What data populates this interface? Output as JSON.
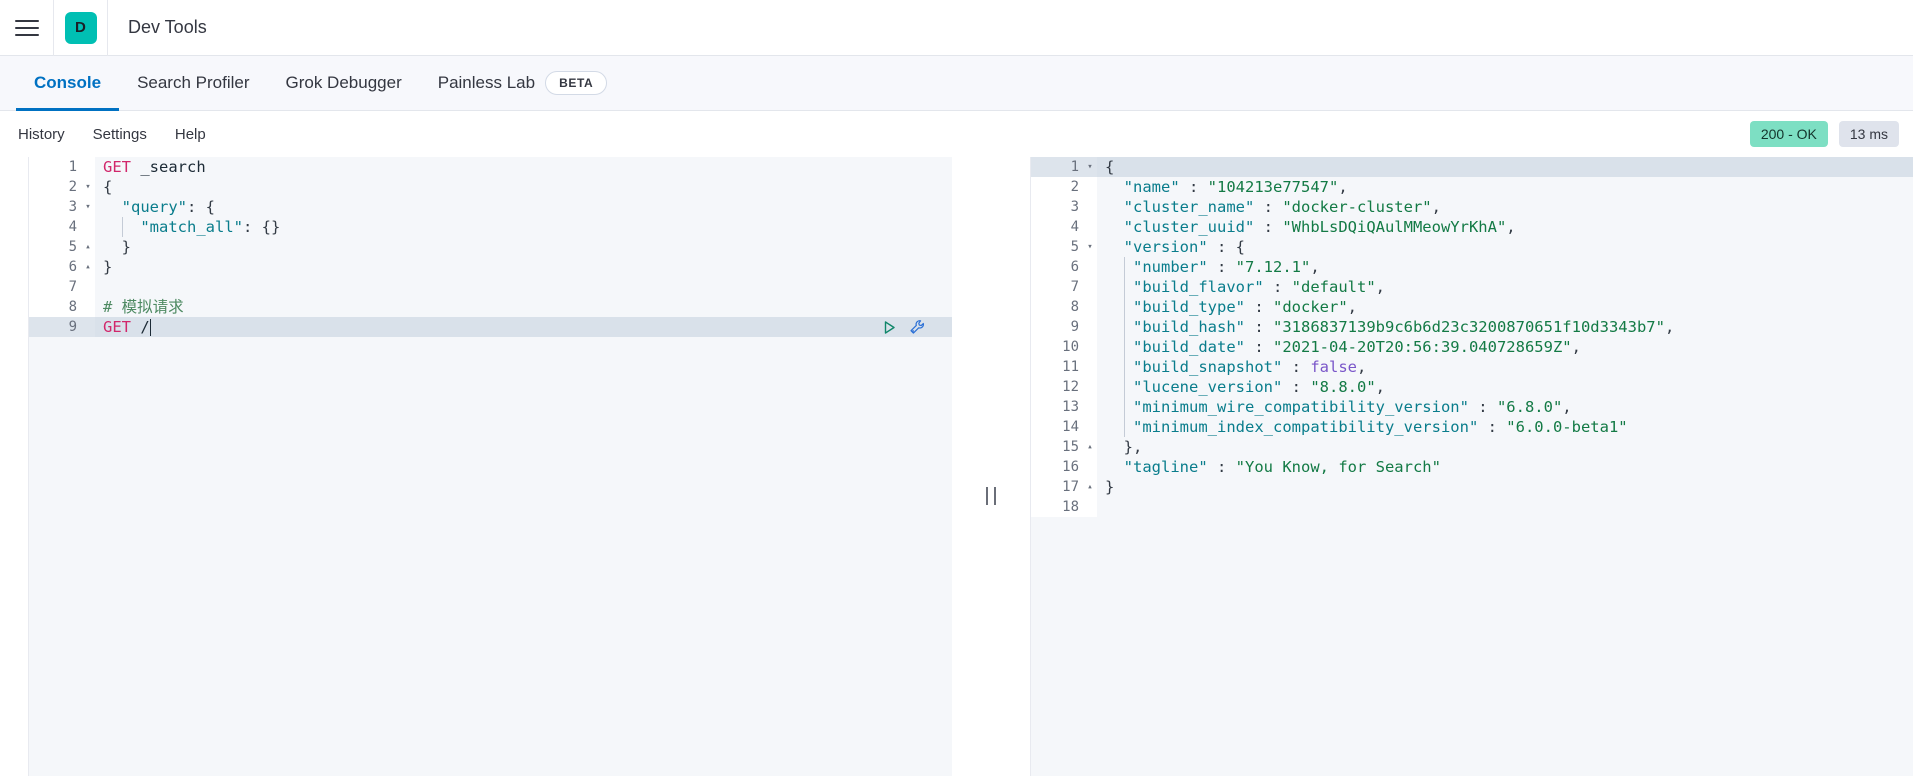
{
  "header": {
    "menu_icon": "hamburger-menu-icon",
    "logo_letter": "D",
    "logo_color": "#00bfb3",
    "title": "Dev Tools"
  },
  "tabs": [
    {
      "label": "Console",
      "active": true,
      "badge": null
    },
    {
      "label": "Search Profiler",
      "active": false,
      "badge": null
    },
    {
      "label": "Grok Debugger",
      "active": false,
      "badge": null
    },
    {
      "label": "Painless Lab",
      "active": false,
      "badge": "BETA"
    }
  ],
  "console_menu": {
    "items": [
      "History",
      "Settings",
      "Help"
    ]
  },
  "status": {
    "code_label": "200 - OK",
    "code_color": "#7ddfc3",
    "time_label": "13 ms",
    "time_color": "#dfe3ec"
  },
  "request_editor": {
    "active_line": 9,
    "actions": [
      {
        "name": "play-request-icon",
        "color": "#10866a"
      },
      {
        "name": "wrench-icon",
        "color": "#2a6fd6"
      }
    ],
    "lines": [
      {
        "n": 1,
        "fold": "",
        "tokens": [
          {
            "t": "GET",
            "c": "k-method"
          },
          {
            "t": " _search",
            "c": "k-url"
          }
        ]
      },
      {
        "n": 2,
        "fold": "▾",
        "tokens": [
          {
            "t": "{",
            "c": "k-punct"
          }
        ]
      },
      {
        "n": 3,
        "fold": "▾",
        "tokens": [
          {
            "t": "  ",
            "c": "k-punct"
          },
          {
            "t": "\"query\"",
            "c": "k-key"
          },
          {
            "t": ": {",
            "c": "k-punct"
          }
        ]
      },
      {
        "n": 4,
        "fold": "",
        "tokens": [
          {
            "t": "  ",
            "c": "k-punct"
          },
          {
            "t": "|",
            "c": "guide"
          },
          {
            "t": "  ",
            "c": "k-punct"
          },
          {
            "t": "\"match_all\"",
            "c": "k-key"
          },
          {
            "t": ": {}",
            "c": "k-punct"
          }
        ]
      },
      {
        "n": 5,
        "fold": "▴",
        "tokens": [
          {
            "t": "  }",
            "c": "k-punct"
          }
        ]
      },
      {
        "n": 6,
        "fold": "▴",
        "tokens": [
          {
            "t": "}",
            "c": "k-punct"
          }
        ]
      },
      {
        "n": 7,
        "fold": "",
        "tokens": []
      },
      {
        "n": 8,
        "fold": "",
        "tokens": [
          {
            "t": "# 模拟请求",
            "c": "k-comment"
          }
        ]
      },
      {
        "n": 9,
        "fold": "",
        "tokens": [
          {
            "t": "GET",
            "c": "k-method"
          },
          {
            "t": " /",
            "c": "k-url"
          },
          {
            "t": "|caret|",
            "c": "caret"
          }
        ]
      }
    ]
  },
  "response_editor": {
    "active_line": 1,
    "lines": [
      {
        "n": 1,
        "fold": "▾",
        "tokens": [
          {
            "t": "{",
            "c": "k-punct"
          }
        ]
      },
      {
        "n": 2,
        "fold": "",
        "tokens": [
          {
            "t": "  ",
            "c": "k-punct"
          },
          {
            "t": "\"name\"",
            "c": "k-rkey"
          },
          {
            "t": " : ",
            "c": "k-punct"
          },
          {
            "t": "\"104213e77547\"",
            "c": "k-str"
          },
          {
            "t": ",",
            "c": "k-punct"
          }
        ]
      },
      {
        "n": 3,
        "fold": "",
        "tokens": [
          {
            "t": "  ",
            "c": "k-punct"
          },
          {
            "t": "\"cluster_name\"",
            "c": "k-rkey"
          },
          {
            "t": " : ",
            "c": "k-punct"
          },
          {
            "t": "\"docker-cluster\"",
            "c": "k-str"
          },
          {
            "t": ",",
            "c": "k-punct"
          }
        ]
      },
      {
        "n": 4,
        "fold": "",
        "tokens": [
          {
            "t": "  ",
            "c": "k-punct"
          },
          {
            "t": "\"cluster_uuid\"",
            "c": "k-rkey"
          },
          {
            "t": " : ",
            "c": "k-punct"
          },
          {
            "t": "\"WhbLsDQiQAulMMeowYrKhA\"",
            "c": "k-str"
          },
          {
            "t": ",",
            "c": "k-punct"
          }
        ]
      },
      {
        "n": 5,
        "fold": "▾",
        "tokens": [
          {
            "t": "  ",
            "c": "k-punct"
          },
          {
            "t": "\"version\"",
            "c": "k-rkey"
          },
          {
            "t": " : {",
            "c": "k-punct"
          }
        ]
      },
      {
        "n": 6,
        "fold": "",
        "tokens": [
          {
            "t": "  ",
            "c": "k-punct"
          },
          {
            "t": "|",
            "c": "guide"
          },
          {
            "t": " ",
            "c": "k-punct"
          },
          {
            "t": "\"number\"",
            "c": "k-rkey"
          },
          {
            "t": " : ",
            "c": "k-punct"
          },
          {
            "t": "\"7.12.1\"",
            "c": "k-str"
          },
          {
            "t": ",",
            "c": "k-punct"
          }
        ]
      },
      {
        "n": 7,
        "fold": "",
        "tokens": [
          {
            "t": "  ",
            "c": "k-punct"
          },
          {
            "t": "|",
            "c": "guide"
          },
          {
            "t": " ",
            "c": "k-punct"
          },
          {
            "t": "\"build_flavor\"",
            "c": "k-rkey"
          },
          {
            "t": " : ",
            "c": "k-punct"
          },
          {
            "t": "\"default\"",
            "c": "k-str"
          },
          {
            "t": ",",
            "c": "k-punct"
          }
        ]
      },
      {
        "n": 8,
        "fold": "",
        "tokens": [
          {
            "t": "  ",
            "c": "k-punct"
          },
          {
            "t": "|",
            "c": "guide"
          },
          {
            "t": " ",
            "c": "k-punct"
          },
          {
            "t": "\"build_type\"",
            "c": "k-rkey"
          },
          {
            "t": " : ",
            "c": "k-punct"
          },
          {
            "t": "\"docker\"",
            "c": "k-str"
          },
          {
            "t": ",",
            "c": "k-punct"
          }
        ]
      },
      {
        "n": 9,
        "fold": "",
        "tokens": [
          {
            "t": "  ",
            "c": "k-punct"
          },
          {
            "t": "|",
            "c": "guide"
          },
          {
            "t": " ",
            "c": "k-punct"
          },
          {
            "t": "\"build_hash\"",
            "c": "k-rkey"
          },
          {
            "t": " : ",
            "c": "k-punct"
          },
          {
            "t": "\"3186837139b9c6b6d23c3200870651f10d3343b7\"",
            "c": "k-str"
          },
          {
            "t": ",",
            "c": "k-punct"
          }
        ]
      },
      {
        "n": 10,
        "fold": "",
        "tokens": [
          {
            "t": "  ",
            "c": "k-punct"
          },
          {
            "t": "|",
            "c": "guide"
          },
          {
            "t": " ",
            "c": "k-punct"
          },
          {
            "t": "\"build_date\"",
            "c": "k-rkey"
          },
          {
            "t": " : ",
            "c": "k-punct"
          },
          {
            "t": "\"2021-04-20T20:56:39.040728659Z\"",
            "c": "k-str"
          },
          {
            "t": ",",
            "c": "k-punct"
          }
        ]
      },
      {
        "n": 11,
        "fold": "",
        "tokens": [
          {
            "t": "  ",
            "c": "k-punct"
          },
          {
            "t": "|",
            "c": "guide"
          },
          {
            "t": " ",
            "c": "k-punct"
          },
          {
            "t": "\"build_snapshot\"",
            "c": "k-rkey"
          },
          {
            "t": " : ",
            "c": "k-punct"
          },
          {
            "t": "false",
            "c": "k-bool"
          },
          {
            "t": ",",
            "c": "k-punct"
          }
        ]
      },
      {
        "n": 12,
        "fold": "",
        "tokens": [
          {
            "t": "  ",
            "c": "k-punct"
          },
          {
            "t": "|",
            "c": "guide"
          },
          {
            "t": " ",
            "c": "k-punct"
          },
          {
            "t": "\"lucene_version\"",
            "c": "k-rkey"
          },
          {
            "t": " : ",
            "c": "k-punct"
          },
          {
            "t": "\"8.8.0\"",
            "c": "k-str"
          },
          {
            "t": ",",
            "c": "k-punct"
          }
        ]
      },
      {
        "n": 13,
        "fold": "",
        "tokens": [
          {
            "t": "  ",
            "c": "k-punct"
          },
          {
            "t": "|",
            "c": "guide"
          },
          {
            "t": " ",
            "c": "k-punct"
          },
          {
            "t": "\"minimum_wire_compatibility_version\"",
            "c": "k-rkey"
          },
          {
            "t": " : ",
            "c": "k-punct"
          },
          {
            "t": "\"6.8.0\"",
            "c": "k-str"
          },
          {
            "t": ",",
            "c": "k-punct"
          }
        ]
      },
      {
        "n": 14,
        "fold": "",
        "tokens": [
          {
            "t": "  ",
            "c": "k-punct"
          },
          {
            "t": "|",
            "c": "guide"
          },
          {
            "t": " ",
            "c": "k-punct"
          },
          {
            "t": "\"minimum_index_compatibility_version\"",
            "c": "k-rkey"
          },
          {
            "t": " : ",
            "c": "k-punct"
          },
          {
            "t": "\"6.0.0-beta1\"",
            "c": "k-str"
          }
        ]
      },
      {
        "n": 15,
        "fold": "▴",
        "tokens": [
          {
            "t": "  },",
            "c": "k-punct"
          }
        ]
      },
      {
        "n": 16,
        "fold": "",
        "tokens": [
          {
            "t": "  ",
            "c": "k-punct"
          },
          {
            "t": "\"tagline\"",
            "c": "k-rkey"
          },
          {
            "t": " : ",
            "c": "k-punct"
          },
          {
            "t": "\"You Know, for Search\"",
            "c": "k-str"
          }
        ]
      },
      {
        "n": 17,
        "fold": "▴",
        "tokens": [
          {
            "t": "}",
            "c": "k-punct"
          }
        ]
      },
      {
        "n": 18,
        "fold": "",
        "tokens": []
      }
    ]
  },
  "splitter": {
    "name": "pane-resize-grip"
  }
}
